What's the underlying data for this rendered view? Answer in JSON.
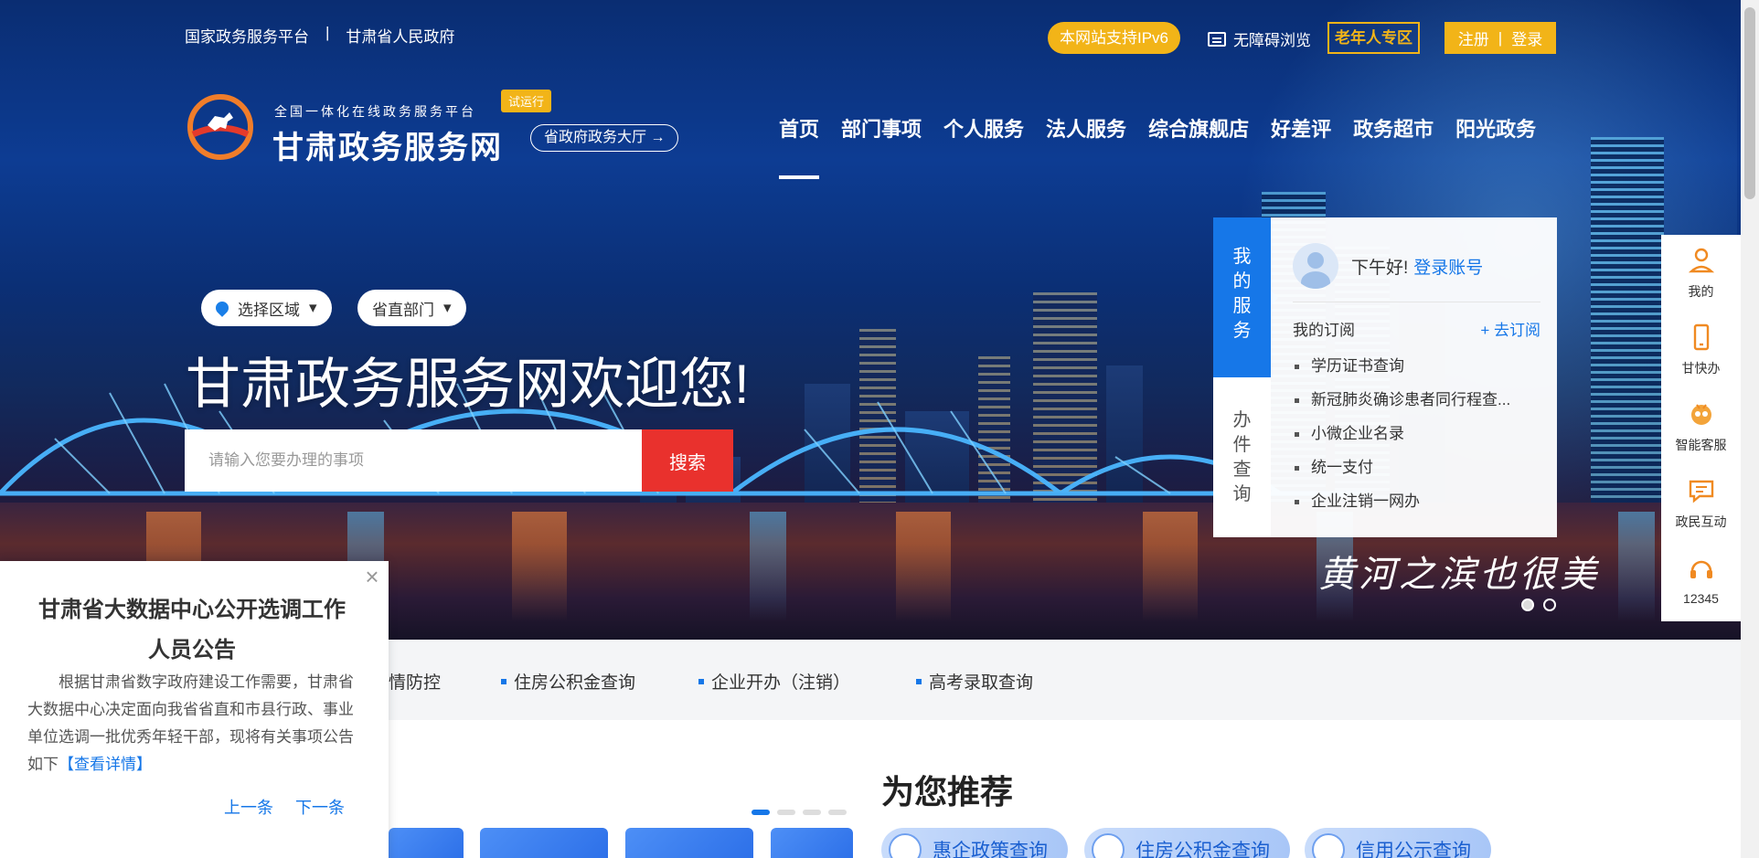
{
  "topbar": {
    "links": [
      "国家政务服务平台",
      "甘肃省人民政府"
    ],
    "separator": "|",
    "ipv6": "本网站支持IPv6",
    "accessibility": "无障碍浏览",
    "elder_zone": "老年人专区",
    "register": "注册",
    "auth_sep": "|",
    "login": "登录"
  },
  "logo": {
    "subtitle": "全国一体化在线政务服务平台",
    "title": "甘肃政务服务网",
    "badge": "试运行",
    "hall_button": "省政府政务大厅 →"
  },
  "nav": {
    "items": [
      "首页",
      "部门事项",
      "个人服务",
      "法人服务",
      "综合旗舰店",
      "好差评",
      "政务超市",
      "阳光政务"
    ],
    "active_index": 0
  },
  "search": {
    "region_select": "选择区域",
    "dept_select": "省直部门",
    "welcome": "甘肃政务服务网欢迎您!",
    "placeholder": "请输入您要办理的事项",
    "button": "搜索"
  },
  "banner": {
    "caption": "黄河之滨也很美",
    "slides": 2,
    "active_slide": 0
  },
  "service_panel": {
    "tab_my_service": "我的服务",
    "tab_query": "办件查询",
    "greeting": "下午好!",
    "login_link": "登录账号",
    "subscriptions_label": "我的订阅",
    "subscribe_link": "+ 去订阅",
    "subscriptions": [
      "学历证书查询",
      "新冠肺炎确诊患者同行程查...",
      "小微企业名录",
      "统一支付",
      "企业注销一网办"
    ]
  },
  "float_bar": {
    "items": [
      {
        "label": "我的",
        "icon": "user-icon"
      },
      {
        "label": "甘快办",
        "icon": "mobile-icon"
      },
      {
        "label": "智能客服",
        "icon": "robot-icon"
      },
      {
        "label": "政民互动",
        "icon": "chat-icon"
      },
      {
        "label": "12345",
        "icon": "headset-icon"
      }
    ]
  },
  "hot_links": [
    "情防控",
    "住房公积金查询",
    "企业开办（注销）",
    "高考录取查询"
  ],
  "recommend": {
    "title": "为您推荐",
    "items": [
      "惠企政策查询",
      "住房公积金查询",
      "信用公示查询"
    ]
  },
  "popup": {
    "title": "甘肃省大数据中心公开选调工作人员公告",
    "body": "根据甘肃省数字政府建设工作需要，甘肃省大数据中心决定面向我省省直和市县行政、事业单位选调一批优秀年轻干部，现将有关事项公告如下",
    "more": "【查看详情】",
    "prev": "上一条",
    "next": "下一条",
    "close": "×"
  },
  "colors": {
    "accent_blue": "#1677e8",
    "gold": "#f2b418",
    "search_red": "#e9312d"
  }
}
